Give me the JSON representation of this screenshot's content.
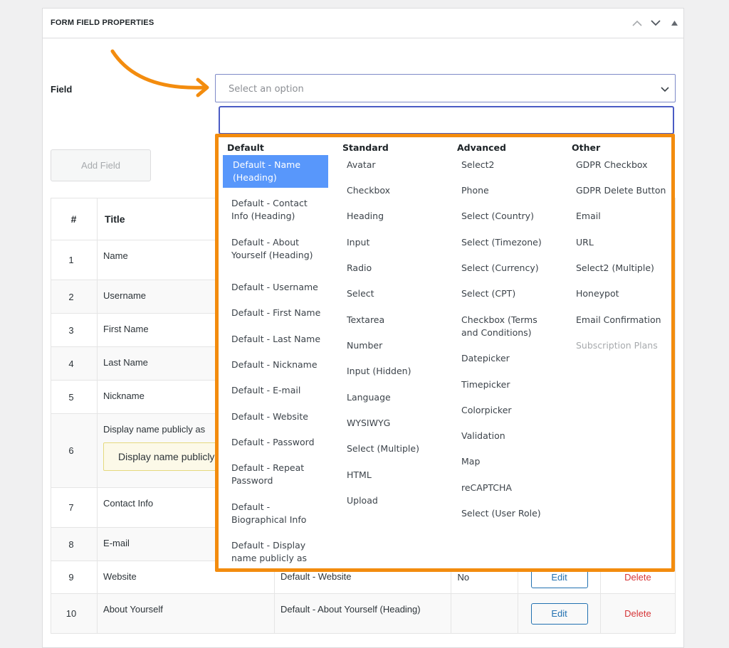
{
  "panel": {
    "title": "FORM FIELD PROPERTIES",
    "controls": [
      "move-up-icon",
      "move-down-icon",
      "collapse-icon"
    ]
  },
  "field": {
    "label": "Field",
    "placeholder": "Select an option",
    "search_value": ""
  },
  "add_field_label": "Add Field",
  "table": {
    "headers": [
      "#",
      "Title"
    ],
    "rows": [
      {
        "num": "1",
        "title": "Name",
        "type": "",
        "req": "",
        "tall": true
      },
      {
        "num": "2",
        "title": "Username",
        "type": "",
        "req": ""
      },
      {
        "num": "3",
        "title": "First Name",
        "type": "",
        "req": ""
      },
      {
        "num": "4",
        "title": "Last Name",
        "type": "",
        "req": ""
      },
      {
        "num": "5",
        "title": "Nickname",
        "type": "",
        "req": ""
      },
      {
        "num": "6",
        "title": "Display name publicly as",
        "type": "",
        "req": "",
        "tooltip": "Display name publicly as"
      },
      {
        "num": "7",
        "title": "Contact Info",
        "type": "",
        "req": ""
      },
      {
        "num": "8",
        "title": "E-mail",
        "type": "",
        "req": ""
      },
      {
        "num": "9",
        "title": "Website",
        "type": "Default - Website",
        "req": "No",
        "edit": "Edit",
        "delete": "Delete"
      },
      {
        "num": "10",
        "title": "About Yourself",
        "type": "Default - About Yourself (Heading)",
        "req": "",
        "edit": "Edit",
        "delete": "Delete"
      }
    ]
  },
  "dropdown": {
    "groups": [
      {
        "label": "Default",
        "options": [
          {
            "label": "Default - Name (Heading)",
            "selected": true
          },
          {
            "label": "Default - Contact Info (Heading)"
          },
          {
            "label": "Default - About Yourself (Heading)"
          },
          {
            "label": "Default - Username"
          },
          {
            "label": "Default - First Name"
          },
          {
            "label": "Default - Last Name"
          },
          {
            "label": "Default - Nickname"
          },
          {
            "label": "Default - E-mail"
          },
          {
            "label": "Default - Website"
          },
          {
            "label": "Default - Password"
          },
          {
            "label": "Default - Repeat Password"
          },
          {
            "label": "Default - Biographical Info"
          },
          {
            "label": "Default - Display name publicly as"
          }
        ]
      },
      {
        "label": "Standard",
        "options": [
          {
            "label": "Avatar"
          },
          {
            "label": "Checkbox"
          },
          {
            "label": "Heading"
          },
          {
            "label": "Input"
          },
          {
            "label": "Radio"
          },
          {
            "label": "Select"
          },
          {
            "label": "Textarea"
          },
          {
            "label": "Number"
          },
          {
            "label": "Input (Hidden)"
          },
          {
            "label": "Language"
          },
          {
            "label": "WYSIWYG"
          },
          {
            "label": "Select (Multiple)"
          },
          {
            "label": "HTML"
          },
          {
            "label": "Upload"
          }
        ]
      },
      {
        "label": "Advanced",
        "options": [
          {
            "label": "Select2"
          },
          {
            "label": "Phone"
          },
          {
            "label": "Select (Country)"
          },
          {
            "label": "Select (Timezone)"
          },
          {
            "label": "Select (Currency)"
          },
          {
            "label": "Select (CPT)"
          },
          {
            "label": "Checkbox (Terms and Conditions)"
          },
          {
            "label": "Datepicker"
          },
          {
            "label": "Timepicker"
          },
          {
            "label": "Colorpicker"
          },
          {
            "label": "Validation"
          },
          {
            "label": "Map"
          },
          {
            "label": "reCAPTCHA"
          },
          {
            "label": "Select (User Role)"
          }
        ]
      },
      {
        "label": "Other",
        "options": [
          {
            "label": "GDPR Checkbox"
          },
          {
            "label": "GDPR Delete Button"
          },
          {
            "label": "Email"
          },
          {
            "label": "URL"
          },
          {
            "label": "Select2 (Multiple)"
          },
          {
            "label": "Honeypot"
          },
          {
            "label": "Email Confirmation"
          },
          {
            "label": "Subscription Plans",
            "disabled": true
          }
        ]
      }
    ]
  },
  "colors": {
    "highlight": "#f38c0e",
    "selected_option": "#5897fb",
    "edit": "#2271b1",
    "delete": "#d63638"
  }
}
